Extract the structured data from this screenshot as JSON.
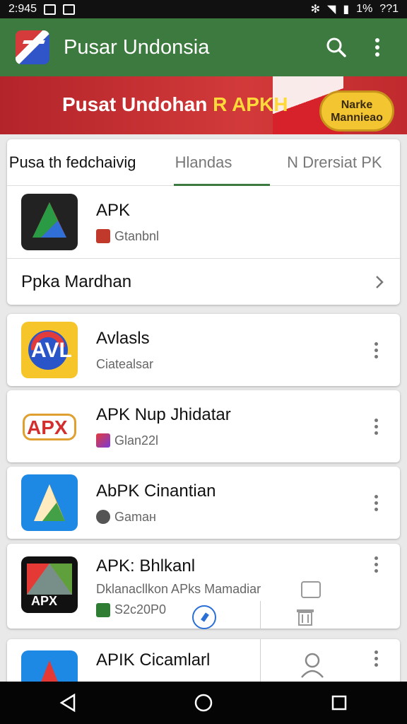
{
  "status": {
    "time": "2:945",
    "battery": "1%",
    "extra": "??1"
  },
  "appbar": {
    "title": "Pusar Undonsia",
    "search_icon": "search-icon",
    "more_icon": "more-vert-icon"
  },
  "banner": {
    "title_main": "Pusat Undohan ",
    "title_accent": "R APKH",
    "badge_line1": "Narke",
    "badge_line2": "Mannieao"
  },
  "tabs": [
    {
      "label": "Pusa th fedchaivig",
      "active": true
    },
    {
      "label": "Hlandas",
      "active": false
    },
    {
      "label": "N Drersiat PK",
      "active": false
    }
  ],
  "featured": {
    "name": "APK",
    "sub": "Gtanbnl"
  },
  "section": {
    "label": "Ppka Mardhan"
  },
  "apps": [
    {
      "name": "Avlasls",
      "sub": "Ciatealsar"
    },
    {
      "name": "APK Nup Jhidatar",
      "sub": "Glan22l"
    },
    {
      "name": "AbPK Cinantian",
      "sub": "Gamaн"
    },
    {
      "name": "APK: Bhlkanl",
      "desc": "Dklanacllkon APks Mamadiar",
      "sub": "S2c20P0"
    },
    {
      "name": "APIK Cicamlarl",
      "sub": ""
    }
  ],
  "icon_labels": {
    "apx_badge": "APX",
    "apx_small": "APX",
    "avl_label": "AVL"
  },
  "colors": {
    "primary": "#3d7a3f",
    "banner": "#c02a2e",
    "accent": "#ffd83a"
  }
}
